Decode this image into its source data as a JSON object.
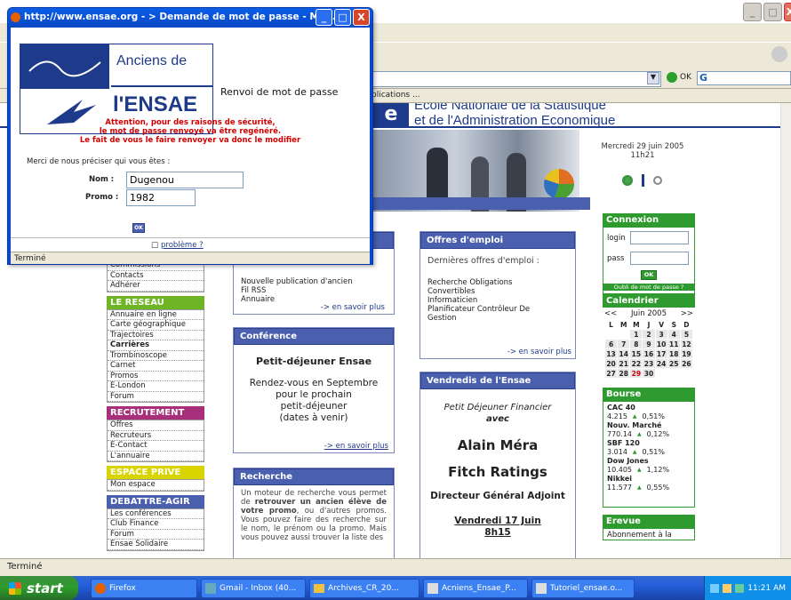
{
  "browser": {
    "address_go": "OK",
    "links_partial": "blications ...",
    "status": "Terminé"
  },
  "site": {
    "logo_letter": "e",
    "title_line1": "Ecole Nationale de la Statistique",
    "title_line2": "et de l'Administration Economique",
    "date": "Mercredi 29 juin 2005",
    "time": "11h21"
  },
  "left_nav": {
    "top_items": [
      "Commissions",
      "Contacts",
      "Adhérer"
    ],
    "reseau": {
      "title": "LE RESEAU",
      "items": [
        "Annuaire en ligne",
        "Carte géographique",
        "Trajectoires",
        "Carrières",
        "Trombinoscope",
        "Carnet",
        "Promos",
        "E-London",
        "Forum"
      ]
    },
    "recrutement": {
      "title": "RECRUTEMENT",
      "items": [
        "Offres",
        "Recruteurs",
        "E-Contact",
        "L'annuaire"
      ]
    },
    "espace": {
      "title": "ESPACE PRIVE",
      "items": [
        "Mon espace"
      ]
    },
    "debattre": {
      "title": "DEBATTRE-AGIR",
      "items": [
        "Les conférences",
        "Club Finance",
        "Forum",
        "Ensae Solidaire"
      ]
    }
  },
  "news_box": {
    "items": [
      "Nouvelle publication d'ancien",
      "Fil RSS",
      "Annuaire"
    ],
    "more": "-> en savoir plus"
  },
  "conference": {
    "title": "Conférence",
    "event": "Petit-déjeuner Ensae",
    "text": [
      "Rendez-vous en Septembre",
      "pour le prochain",
      "petit-déjeuner",
      "(dates à venir)"
    ],
    "more": "-> en savoir plus"
  },
  "recherche": {
    "title": "Recherche",
    "text_pre": "Un moteur de recherche vous permet de ",
    "text_bold": "retrouver un ancien élève de votre promo",
    "text_post": ", ou d'autres promos. Vous pouvez faire des recherche sur le nom, le prénom ou la promo. Mais vous pouvez aussi trouver la liste des"
  },
  "offres": {
    "title": "Offres d'emploi",
    "subtitle": "Dernières offres d'emploi :",
    "items": [
      "Recherche Obligations",
      "Convertibles",
      "Informaticien",
      "Planificateur Contrôleur De",
      "Gestion"
    ],
    "more": "-> en savoir plus"
  },
  "vendredis": {
    "title": "Vendredis de l'Ensae",
    "line1": "Petit Déjeuner Financier",
    "line2": "avec",
    "speaker": "Alain Méra",
    "company": "Fitch Ratings",
    "role": "Directeur Général Adjoint",
    "date1": "Vendredi 17 Juin",
    "date2": "8h15"
  },
  "connexion": {
    "title": "Connexion",
    "login_label": "login",
    "pass_label": "pass",
    "ok": "OK",
    "forgot": "Oubli de mot de passe ?"
  },
  "calendar": {
    "title": "Calendrier",
    "prev": "<<",
    "month": "Juin 2005",
    "next": ">>",
    "days": [
      "L",
      "M",
      "M",
      "J",
      "V",
      "S",
      "D"
    ],
    "weeks": [
      [
        "",
        "",
        "1",
        "2",
        "3",
        "4",
        "5"
      ],
      [
        "6",
        "7",
        "8",
        "9",
        "10",
        "11",
        "12"
      ],
      [
        "13",
        "14",
        "15",
        "16",
        "17",
        "18",
        "19"
      ],
      [
        "20",
        "21",
        "22",
        "23",
        "24",
        "25",
        "26"
      ],
      [
        "27",
        "28",
        "29",
        "30",
        "",
        "",
        ""
      ]
    ],
    "today": "29"
  },
  "bourse": {
    "title": "Bourse",
    "indices": [
      {
        "name": "CAC 40",
        "value": "4.215",
        "change": "0,51%"
      },
      {
        "name": "Nouv. Marché",
        "value": "770.14",
        "change": "0,12%"
      },
      {
        "name": "SBF 120",
        "value": "3.014",
        "change": "0,51%"
      },
      {
        "name": "Dow Jones",
        "value": "10.405",
        "change": "1,12%"
      },
      {
        "name": "Nikkei",
        "value": "11.577",
        "change": "0,55%"
      }
    ]
  },
  "erevue": {
    "title": "Erevue",
    "text": "Abonnement à la"
  },
  "popup": {
    "title": "http://www.ensae.org - > Demande de mot de passe - Mo...",
    "logo_line1": "Anciens de",
    "logo_line2": "l'ENSAE",
    "heading": "Renvoi de mot de passe",
    "warning_lines": [
      "Attention, pour des raisons de sécurité,",
      "le mot de passe renvoyé va être regénéré.",
      "Le fait de vous le faire renvoyer va donc le modifier"
    ],
    "prompt": "Merci de nous préciser qui vous êtes :",
    "nom_label": "Nom :",
    "nom_value": "Dugenou",
    "promo_label": "Promo :",
    "promo_value": "1982",
    "ok": "OK",
    "problem_link": "problème ?",
    "status": "Terminé"
  },
  "taskbar": {
    "start": "start",
    "items": [
      "Firefox",
      "Gmail - Inbox (40...",
      "Archives_CR_20...",
      "Acniens_Ensae_P...",
      "Tutoriel_ensae.o..."
    ],
    "clock": "11:21 AM"
  },
  "colors": {
    "navy": "#1e3a8a",
    "box_head": "#4a5fae",
    "green": "#2f9a2f",
    "reseau": "#6fb424",
    "recrutement": "#a8307a",
    "espace": "#d9d400",
    "debattre": "#4a5fae",
    "warning": "#d40000"
  }
}
